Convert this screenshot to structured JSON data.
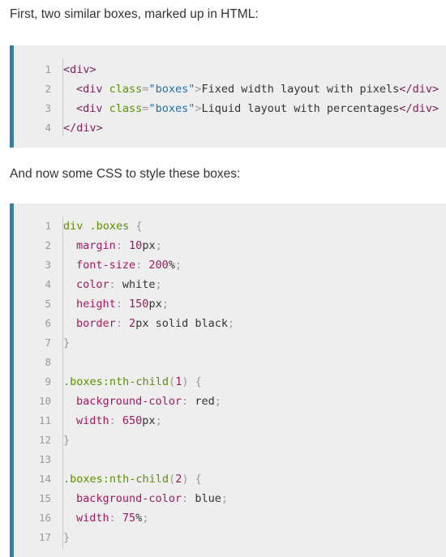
{
  "intro_text": "First, two similar boxes, marked up in HTML:",
  "css_intro_text": "And now some CSS to style these boxes:",
  "html_block": {
    "line_numbers": [
      "1",
      "2",
      "3",
      "4"
    ],
    "div_open": "<div>",
    "child_open_1": "<div",
    "class_attr_1": "class",
    "equals_1": "=",
    "class_value_1": "\"boxes\"",
    "close_bracket_1": ">",
    "text_1": "Fixed width layout with pixels",
    "child_close_1": "</div>",
    "child_open_2": "<div",
    "class_attr_2": "class",
    "equals_2": "=",
    "class_value_2": "\"boxes\"",
    "close_bracket_2": ">",
    "text_2": "Liquid layout with percentages",
    "child_close_2": "</div>",
    "div_close": "</div>"
  },
  "css_block": {
    "line_numbers": [
      "1",
      "2",
      "3",
      "4",
      "5",
      "6",
      "7",
      "8",
      "9",
      "10",
      "11",
      "12",
      "13",
      "14",
      "15",
      "16",
      "17"
    ],
    "rule1": {
      "selector": "div .boxes",
      "open_brace": "{",
      "declarations": [
        {
          "prop": "margin",
          "num": "10",
          "unit": "px"
        },
        {
          "prop": "font-size",
          "num": "200",
          "unit": "%"
        },
        {
          "prop": "color",
          "value": "white"
        },
        {
          "prop": "height",
          "num": "150",
          "unit": "px"
        },
        {
          "prop": "border",
          "num": "2",
          "unit": "px",
          "rest": "solid black"
        }
      ],
      "close_brace": "}"
    },
    "rule2": {
      "selector": ".boxes:nth-child",
      "arg": "1",
      "open_brace": "{",
      "declarations": [
        {
          "prop": "background-color",
          "value": "red"
        },
        {
          "prop": "width",
          "num": "650",
          "unit": "px"
        }
      ],
      "close_brace": "}"
    },
    "rule3": {
      "selector": ".boxes:nth-child",
      "arg": "2",
      "open_brace": "{",
      "declarations": [
        {
          "prop": "background-color",
          "value": "blue"
        },
        {
          "prop": "width",
          "num": "75",
          "unit": "%"
        }
      ],
      "close_brace": "}"
    }
  },
  "colors": {
    "block_background": "#eeeeee",
    "block_accent": "#3f7ba1",
    "tag": "#7a1f5a",
    "attribute": "#5e8f00",
    "string": "#1f6fa8",
    "property": "#a0195f"
  }
}
